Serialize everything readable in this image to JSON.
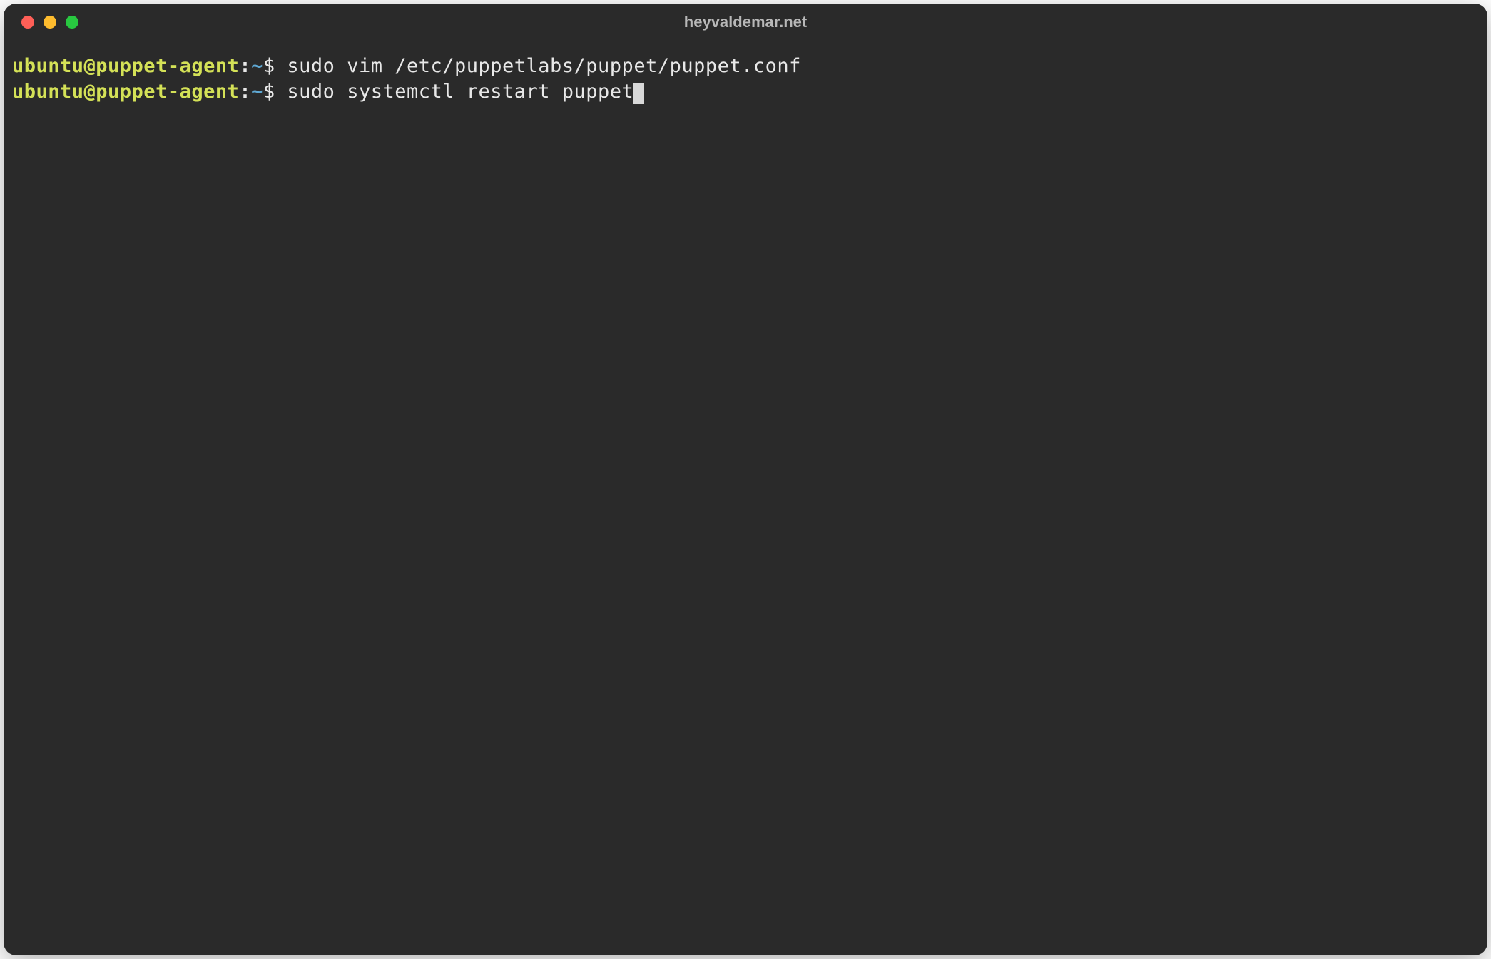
{
  "window": {
    "title": "heyvaldemar.net",
    "traffic_lights": {
      "close": "close-button",
      "minimize": "minimize-button",
      "maximize": "maximize-button"
    }
  },
  "terminal": {
    "lines": [
      {
        "prompt_user": "ubuntu@puppet-agent",
        "prompt_colon": ":",
        "prompt_path": "~",
        "prompt_symbol": "$",
        "command": " sudo vim /etc/puppetlabs/puppet/puppet.conf",
        "has_cursor": false
      },
      {
        "prompt_user": "ubuntu@puppet-agent",
        "prompt_colon": ":",
        "prompt_path": "~",
        "prompt_symbol": "$",
        "command": " sudo systemctl restart puppet",
        "has_cursor": true
      }
    ]
  },
  "colors": {
    "background": "#2a2a2a",
    "prompt_user": "#d4e157",
    "prompt_path": "#5fa8d3",
    "text": "#e8e8e8",
    "title": "#b8b8b8",
    "traffic_red": "#ff5f57",
    "traffic_yellow": "#febc2e",
    "traffic_green": "#28c840"
  }
}
